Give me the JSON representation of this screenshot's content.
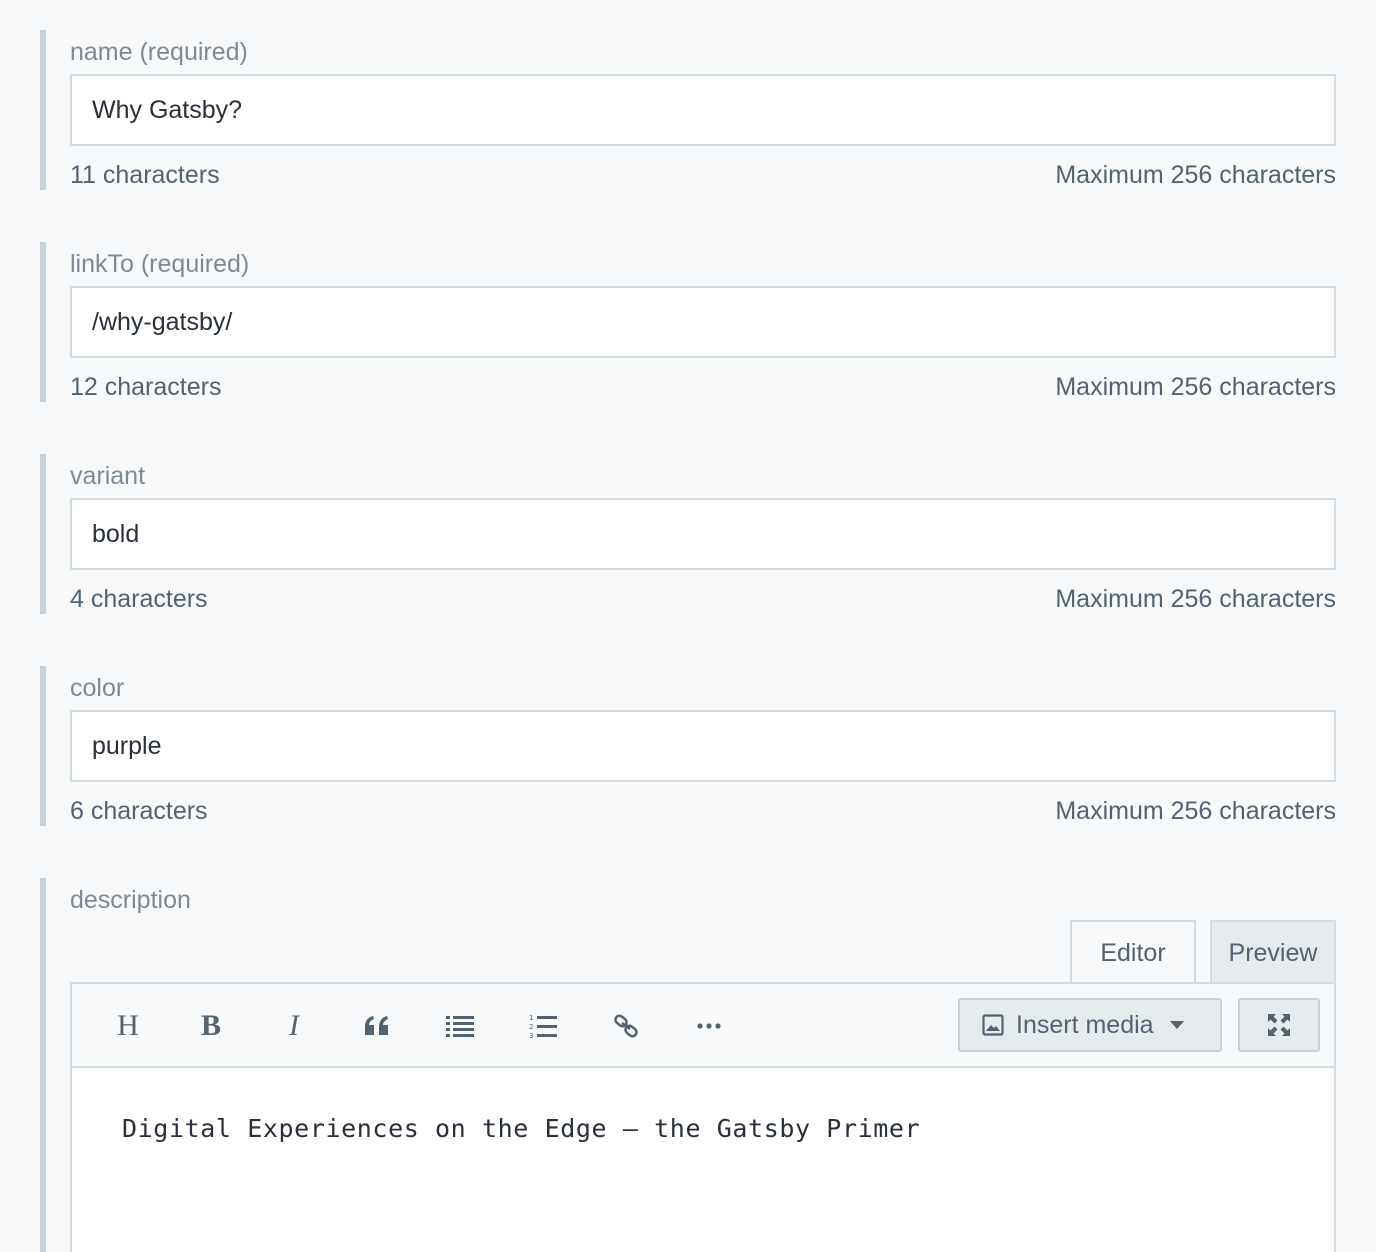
{
  "fields": [
    {
      "label": "name (required)",
      "value": "Why Gatsby?",
      "count": "11 characters",
      "max": "Maximum 256 characters"
    },
    {
      "label": "linkTo (required)",
      "value": "/why-gatsby/",
      "count": "12 characters",
      "max": "Maximum 256 characters"
    },
    {
      "label": "variant",
      "value": "bold",
      "count": "4 characters",
      "max": "Maximum 256 characters"
    },
    {
      "label": "color",
      "value": "purple",
      "count": "6 characters",
      "max": "Maximum 256 characters"
    }
  ],
  "description": {
    "label": "description",
    "tabs": {
      "editor": "Editor",
      "preview": "Preview"
    },
    "toolbar": {
      "heading": "H",
      "bold": "B",
      "italic": "I",
      "insert_media": "Insert media",
      "icons": [
        "heading-icon",
        "bold-icon",
        "italic-icon",
        "quote-icon",
        "unordered-list-icon",
        "ordered-list-icon",
        "link-icon",
        "more-icon",
        "image-icon",
        "chevron-down-icon",
        "fullscreen-icon"
      ]
    },
    "content": "Digital Experiences on the Edge – the Gatsby Primer"
  },
  "colors": {
    "background": "#f7f9fa",
    "border": "#d3dce0",
    "label": "#7d8a96",
    "text": "#2a3039",
    "muted": "#536171",
    "field_accent": "#c5d2d9"
  }
}
